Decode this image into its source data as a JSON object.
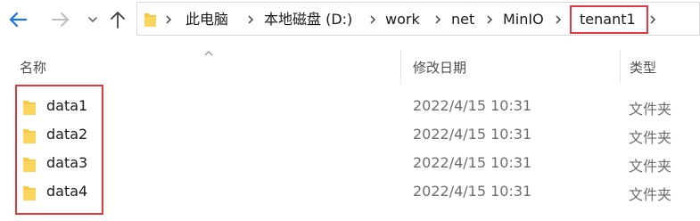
{
  "breadcrumb": [
    "此电脑",
    "本地磁盘 (D:)",
    "work",
    "net",
    "MinIO",
    "tenant1"
  ],
  "columns": {
    "name": "名称",
    "modified": "修改日期",
    "type": "类型"
  },
  "rows": [
    {
      "name": "data1",
      "modified": "2022/4/15 10:31",
      "type": "文件夹"
    },
    {
      "name": "data2",
      "modified": "2022/4/15 10:31",
      "type": "文件夹"
    },
    {
      "name": "data3",
      "modified": "2022/4/15 10:31",
      "type": "文件夹"
    },
    {
      "name": "data4",
      "modified": "2022/4/15 10:31",
      "type": "文件夹"
    }
  ],
  "icons": {
    "back": "arrow-left-icon",
    "forward": "arrow-right-icon",
    "recent": "chevron-down-icon",
    "up": "arrow-up-icon",
    "folder": "folder-icon",
    "separator": "chevron-right-icon",
    "sort": "sort-up-icon"
  },
  "colors": {
    "accent": "#1a73e8",
    "highlight": "#e0383e",
    "folder": "#f8c743"
  }
}
